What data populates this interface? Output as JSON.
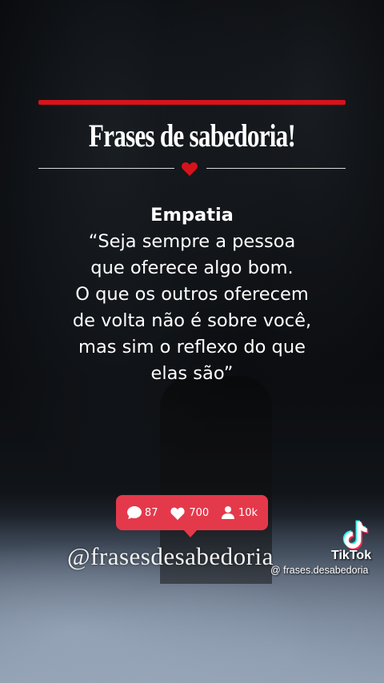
{
  "header": {
    "title": "Frases de sabedoria!"
  },
  "quote": {
    "heading": "Empatia",
    "lines": [
      "“Seja sempre a pessoa",
      "que oferece algo bom.",
      "O que os outros oferecem",
      "de volta não é sobre você,",
      "mas sim o reflexo do que",
      "elas são”"
    ]
  },
  "stats": {
    "comments": "87",
    "likes": "700",
    "followers": "10k"
  },
  "footer": {
    "handle": "@frasesdesabedoria",
    "tiktok_brand": "TikTok",
    "tiktok_user": "@ frases.desabedoria"
  },
  "colors": {
    "accent_red": "#d6131b",
    "badge_pink": "#e4394b"
  },
  "icons": [
    "heart-icon",
    "comment-icon",
    "like-heart-icon",
    "follower-icon",
    "tiktok-logo-icon"
  ]
}
